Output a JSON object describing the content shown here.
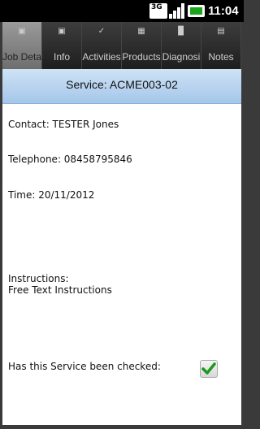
{
  "status_bar": {
    "network": "3G",
    "time": "11:04"
  },
  "tabs": [
    {
      "label": "Job Deta",
      "active": true
    },
    {
      "label": "Info"
    },
    {
      "label": "Activities"
    },
    {
      "label": "Products"
    },
    {
      "label": "Diagnosi"
    },
    {
      "label": "Notes"
    }
  ],
  "header": {
    "title": "Service: ACME003-02"
  },
  "fields": {
    "contact": "Contact: TESTER Jones",
    "telephone": "Telephone: 08458795846",
    "time": "Time: 20/11/2012",
    "instructions_label": "Instructions:",
    "instructions_text": "Free Text Instructions",
    "checked_label": "Has this Service been checked:"
  },
  "checked": true,
  "colors": {
    "check": "#1a9a1a",
    "header_top": "#cfe2f5",
    "header_bottom": "#a4c6ea"
  }
}
